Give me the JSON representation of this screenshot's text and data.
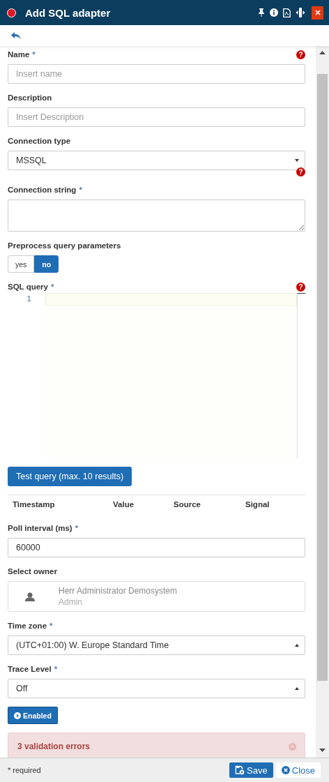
{
  "header": {
    "title": "Add SQL adapter"
  },
  "fields": [
    {
      "kind": "text",
      "label": "Name",
      "mark": "*",
      "help": "?",
      "placeholder": "Insert name"
    },
    {
      "kind": "text",
      "label": "Description",
      "placeholder": "Insert Description"
    },
    {
      "kind": "select",
      "label": "Connection type",
      "value": "MSSQL",
      "expanded": false,
      "help": "?"
    },
    {
      "kind": "textarea",
      "label": "Connection string",
      "mark": "*"
    },
    {
      "kind": "toggle",
      "label": "Preprocess query parameters",
      "options": [
        {
          "label": "yes",
          "selected": false
        },
        {
          "label": "no",
          "selected": true
        }
      ]
    },
    {
      "kind": "code",
      "label": "SQL query",
      "mark": "*",
      "help": "?",
      "line_numbers": [
        "1"
      ]
    },
    {
      "kind": "button",
      "label": "Test query (max. 10 results)"
    },
    {
      "kind": "table",
      "columns": [
        "Timestamp",
        "Value",
        "Source",
        "Signal"
      ]
    },
    {
      "kind": "text",
      "label": "Poll interval (ms)",
      "mark": "*",
      "value": "60000"
    },
    {
      "kind": "owner",
      "label": "Select owner",
      "name": "Herr Administrator Demosystem",
      "role": "Admin"
    },
    {
      "kind": "select",
      "label": "Time zone",
      "mark": "*",
      "value": "(UTC+01:00) W. Europe Standard Time",
      "expanded": true
    },
    {
      "kind": "select",
      "label": "Trace Level",
      "mark": "*",
      "value": "Off",
      "expanded": true
    },
    {
      "kind": "enable",
      "label": "Enabled"
    },
    {
      "kind": "alert",
      "title": "3 validation errors"
    }
  ],
  "footer": {
    "note": "* required",
    "buttons": [
      {
        "kind": "save",
        "label": "Save"
      },
      {
        "kind": "close",
        "label": "Close"
      }
    ]
  }
}
